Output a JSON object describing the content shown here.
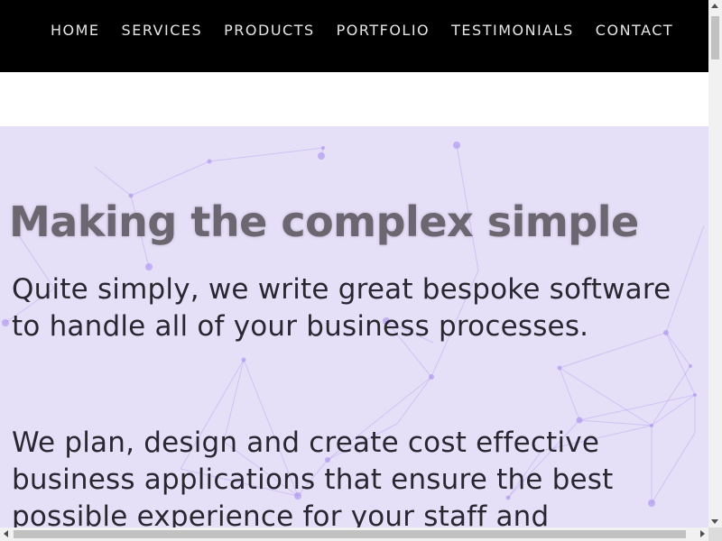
{
  "nav": {
    "items": [
      {
        "label": "HOME"
      },
      {
        "label": "SERVICES"
      },
      {
        "label": "PRODUCTS"
      },
      {
        "label": "PORTFOLIO"
      },
      {
        "label": "TESTIMONIALS"
      },
      {
        "label": "CONTACT"
      }
    ]
  },
  "hero": {
    "heading": "Making the complex simple",
    "paragraph1": "Quite simply, we write great bespoke software to handle all of your business processes.",
    "paragraph2": "We plan, design and create cost effective business applications that ensure the best possible experience for your staff and"
  },
  "colors": {
    "nav_background": "#000000",
    "nav_text": "#e6e6e6",
    "hero_background": "#e5dff7",
    "network_accent": "#a98ef0",
    "heading_text": "#6b6670",
    "body_text": "#2b2731"
  }
}
